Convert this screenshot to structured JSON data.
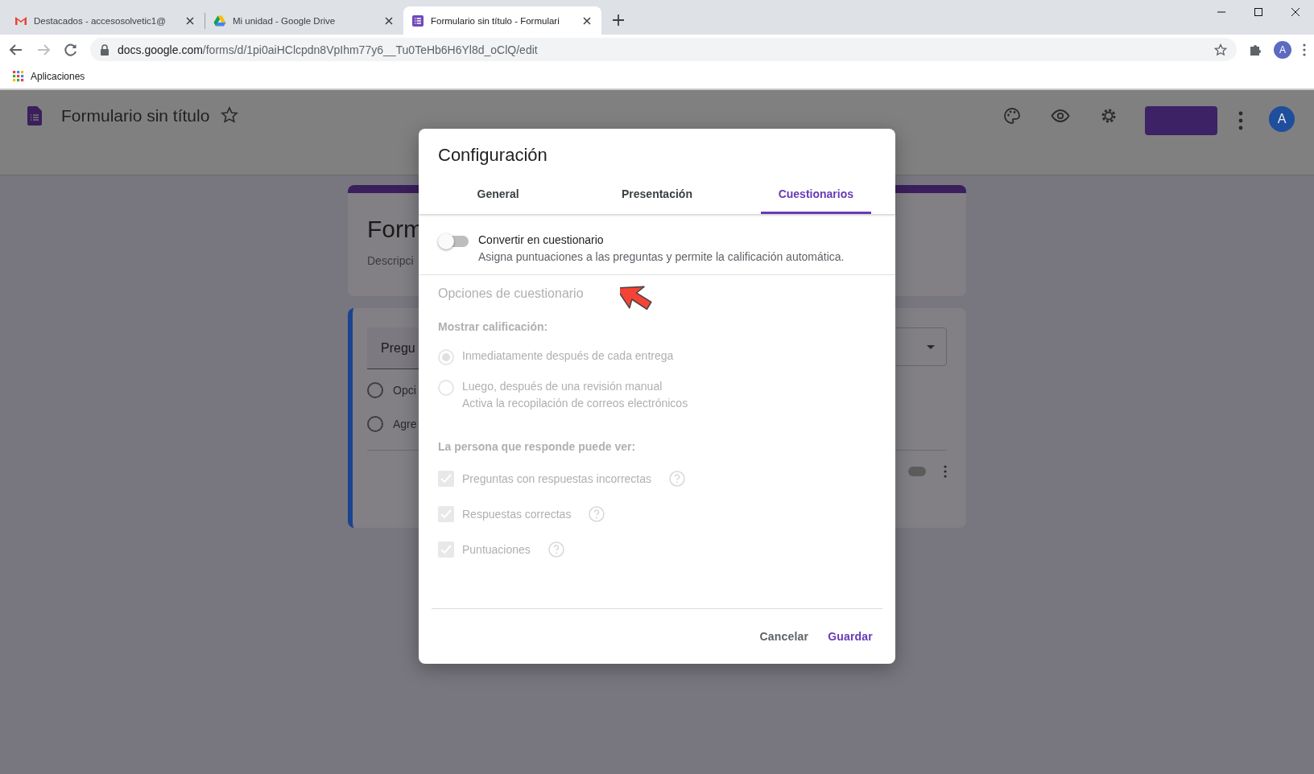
{
  "browser": {
    "tabs": [
      {
        "kind": "mail",
        "title": "Destacados - accesosolvetic1@",
        "selected": false
      },
      {
        "kind": "drive",
        "title": "Mi unidad - Google Drive",
        "selected": false
      },
      {
        "kind": "forms",
        "title": "Formulario sin título - Formulari",
        "selected": true
      }
    ],
    "address_bar": {
      "domain": "docs.google.com",
      "path": "/forms/d/1pi0aiHClcpdn8VpIhm77y6__Tu0TeHb6H6Yl8d_oClQ/edit"
    },
    "profile_initial": "A",
    "bookmarks": [
      {
        "label": "Aplicaciones"
      }
    ]
  },
  "app_header": {
    "title": "Formulario sin título",
    "avatar_initial": "A"
  },
  "form": {
    "title": "Form",
    "description": "Descripci",
    "question": "Pregu",
    "options": [
      {
        "label": "Opci",
        "selected": false
      },
      {
        "label": "Agre",
        "selected": false
      }
    ],
    "required_toggle": {
      "on": false
    }
  },
  "dialog": {
    "title": "Configuración",
    "tabs": [
      {
        "label": "General",
        "selected": false
      },
      {
        "label": "Presentación",
        "selected": false
      },
      {
        "label": "Cuestionarios",
        "selected": true
      }
    ],
    "quiz_toggle": {
      "label": "Convertir en cuestionario",
      "description": "Asigna puntuaciones a las preguntas y permite la calificación automática.",
      "on": false
    },
    "quiz_options": {
      "disabled": true,
      "heading": "Opciones de cuestionario",
      "show_grade": {
        "label": "Mostrar calificación:",
        "options": [
          {
            "label": "Inmediatamente después de cada entrega",
            "selected": true
          },
          {
            "label": "Luego, después de una revisión manual",
            "sublabel": "Activa la recopilación de correos electrónicos",
            "selected": false
          }
        ]
      },
      "respondent_sees": {
        "label": "La persona que responde puede ver:",
        "items": [
          {
            "label": "Preguntas con respuestas incorrectas",
            "checked": true
          },
          {
            "label": "Respuestas correctas",
            "checked": true
          },
          {
            "label": "Puntuaciones",
            "checked": true
          }
        ]
      }
    },
    "buttons": [
      {
        "kind": "secondary",
        "label": "Cancelar"
      },
      {
        "kind": "primary",
        "label": "Guardar"
      }
    ]
  }
}
